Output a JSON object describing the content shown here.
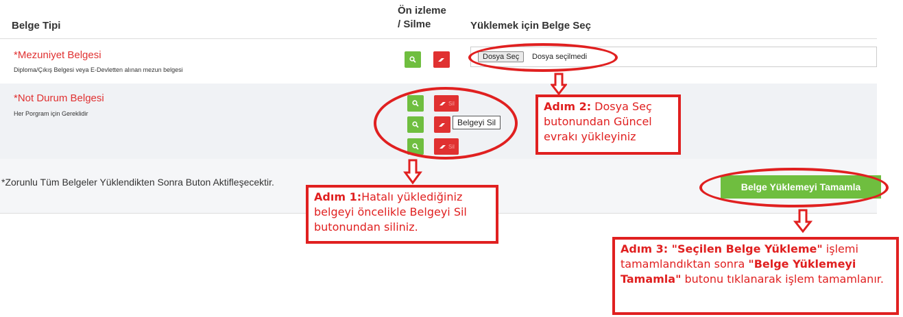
{
  "table": {
    "headers": {
      "doc_type": "Belge Tipi",
      "preview_line1": "Ön izleme",
      "preview_line2": "/ Silme",
      "upload": "Yüklemek için Belge Seç"
    },
    "rows": [
      {
        "title": "*Mezuniyet Belgesi",
        "desc": "Diploma/Çıkış Belgesi veya E-Devletten alınan mezun belgesi",
        "file_button": "Dosya Seç",
        "file_status": "Dosya seçilmedi"
      },
      {
        "title": "*Not Durum Belgesi",
        "desc": "Her Porgram için Gereklidir",
        "delete_ghost_label": "Sil"
      }
    ]
  },
  "tooltip": "Belgeyi Sil",
  "footer": {
    "note": "*Zorunlu Tüm Belgeler Yüklendikten Sonra Buton Aktifleşecektir.",
    "complete_button": "Belge Yüklemeyi Tamamla"
  },
  "callouts": {
    "step1": {
      "bold": "Adım 1:",
      "text": "Hatalı yüklediğiniz belgeyi öncelikle Belgeyi Sil butonundan siliniz."
    },
    "step2": {
      "bold": "Adım 2:",
      "text": " Dosya Seç butonundan Güncel evrakı yükleyiniz"
    },
    "step3": {
      "bold1": "Adım 3: \"Seçilen Belge Yükleme\"",
      "text1": " işlemi tamamlandıktan sonra ",
      "bold2": "\"Belge Yüklemeyi Tamamla\"",
      "text2": " butonu tıklanarak işlem tamamlanır."
    }
  },
  "colors": {
    "accent_red": "#e02020",
    "doc_red": "#e03131",
    "green": "#6fbe3f",
    "band": "#f0f2f5"
  },
  "icons": {
    "preview": "search-icon",
    "delete": "eraser-icon",
    "arrow": "down-arrow-icon"
  }
}
